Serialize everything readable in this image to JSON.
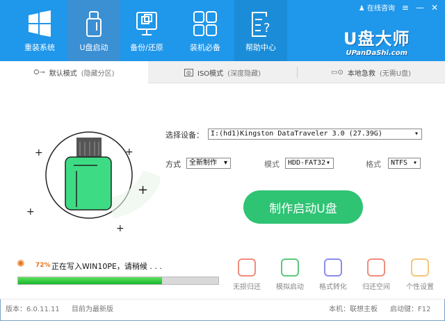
{
  "header": {
    "nav": [
      {
        "label": "重装系统"
      },
      {
        "label": "U盘启动"
      },
      {
        "label": "备份/还原"
      },
      {
        "label": "装机必备"
      },
      {
        "label": "帮助中心"
      }
    ],
    "online_help": "在线咨询",
    "logo_title": "U盘大师",
    "logo_sub": "UPanDaShi.com"
  },
  "tabs": [
    {
      "label": "默认模式",
      "note": "(隐藏分区)"
    },
    {
      "label": "ISO模式",
      "note": "(深度隐藏)"
    },
    {
      "label": "本地急救",
      "note": "(无需U盘)"
    }
  ],
  "form": {
    "device_label": "选择设备：",
    "device_value": "I:(hd1)Kingston DataTraveler 3.0 (27.39G)",
    "method_label": "方式",
    "method_value": "全新制作",
    "mode_label": "模式",
    "mode_value": "HDD-FAT32",
    "format_label": "格式",
    "format_value": "NTFS"
  },
  "make_button": "制作启动U盘",
  "progress": {
    "percent_text": "72%",
    "value": 72,
    "status": "正在写入WIN10PE，请稍候 . . ."
  },
  "tools": [
    {
      "label": "无损归还",
      "color": "#f08c7c"
    },
    {
      "label": "模拟启动",
      "color": "#5bc97a"
    },
    {
      "label": "格式转化",
      "color": "#8c8cf0"
    },
    {
      "label": "归还空间",
      "color": "#f08c7c"
    },
    {
      "label": "个性设置",
      "color": "#f5c67a"
    }
  ],
  "footer": {
    "version": "版本：6.0.11.11",
    "latest": "目前为最新版",
    "machine": "本机：联想主板",
    "boot_key": "启动键：F12"
  }
}
